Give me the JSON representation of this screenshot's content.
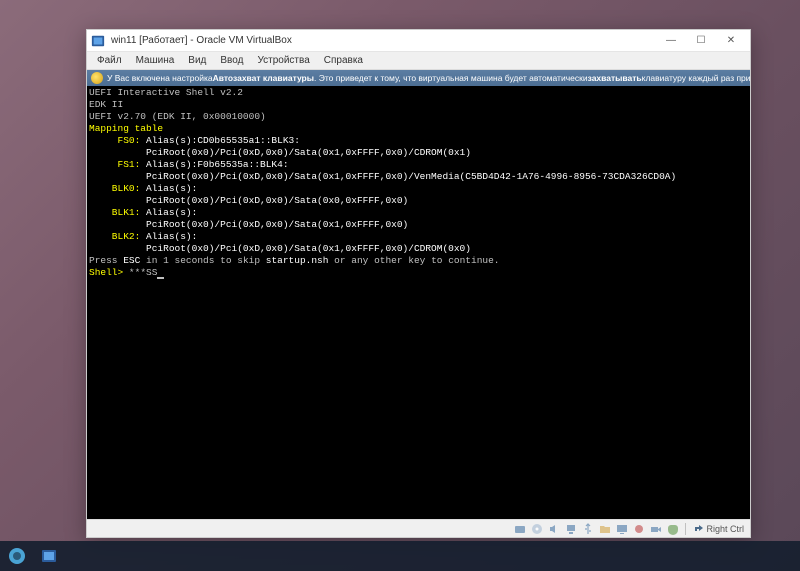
{
  "titlebar": {
    "title": "win11 [Работает] - Oracle VM VirtualBox",
    "minimize": "—",
    "maximize": "☐",
    "close": "✕"
  },
  "menubar": {
    "items": [
      "Файл",
      "Машина",
      "Вид",
      "Ввод",
      "Устройства",
      "Справка"
    ]
  },
  "infobar": {
    "prefix": "У Вас включена настройка ",
    "bold1": "Автозахват клавиатуры",
    "mid": ". Это приведет к тому, что виртуальная машина будет автоматически ",
    "bold2": "захватывать",
    "suffix": " клавиатуру каждый раз при переключении"
  },
  "shell": {
    "header1": "UEFI Interactive Shell v2.2",
    "header2": "EDK II",
    "header3": "UEFI v2.70 (EDK II, 0x00010000)",
    "mapping_title": "Mapping table",
    "fs0_label": "     FS0:",
    "fs0_alias": " Alias(s):CD0b65535a1::BLK3:",
    "fs0_path": "          PciRoot(0x0)/Pci(0xD,0x0)/Sata(0x1,0xFFFF,0x0)/CDROM(0x1)",
    "fs1_label": "     FS1:",
    "fs1_alias": " Alias(s):F0b65535a::BLK4:",
    "fs1_path": "          PciRoot(0x0)/Pci(0xD,0x0)/Sata(0x1,0xFFFF,0x0)/VenMedia(C5BD4D42-1A76-4996-8956-73CDA326CD0A)",
    "blk0_label": "    BLK0:",
    "blk0_alias": " Alias(s):",
    "blk0_path": "          PciRoot(0x0)/Pci(0xD,0x0)/Sata(0x0,0xFFFF,0x0)",
    "blk1_label": "    BLK1:",
    "blk1_alias": " Alias(s):",
    "blk1_path": "          PciRoot(0x0)/Pci(0xD,0x0)/Sata(0x1,0xFFFF,0x0)",
    "blk2_label": "    BLK2:",
    "blk2_alias": " Alias(s):",
    "blk2_path": "          PciRoot(0x0)/Pci(0xD,0x0)/Sata(0x1,0xFFFF,0x0)/CDROM(0x0)",
    "press1": "Press ",
    "esc": "ESC",
    "press2": " in 1 seconds to skip ",
    "startup": "startup.nsh",
    "press3": " or any other key to continue.",
    "prompt": "Shell> ",
    "input": "***SS"
  },
  "statusbar": {
    "hostkey": "Right Ctrl",
    "icons": [
      "disk-icon",
      "cd-icon",
      "usb-icon",
      "audio-icon",
      "network-icon",
      "folder-icon",
      "display-icon",
      "record-icon",
      "camera-icon",
      "mouse-icon"
    ]
  }
}
